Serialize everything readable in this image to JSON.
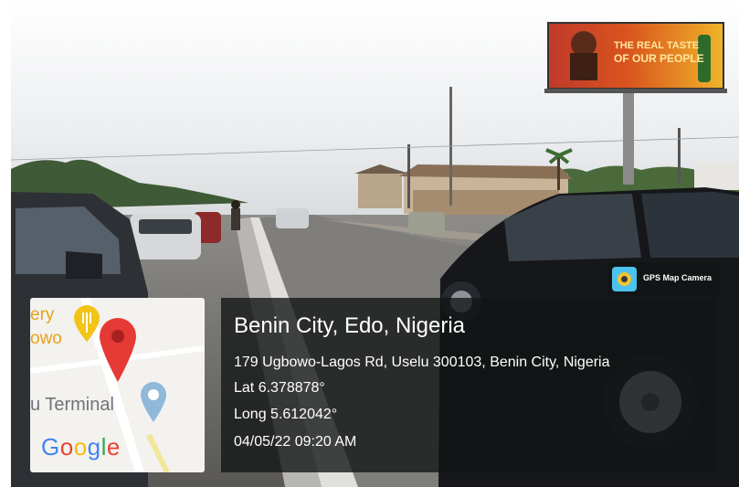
{
  "billboard": {
    "line1": "THE REAL TASTE",
    "line2": "OF OUR PEOPLE"
  },
  "map": {
    "poi_top_1": "ery",
    "poi_top_2": "owo",
    "poi_terminal": "u Terminal",
    "logo_letters": [
      "G",
      "o",
      "o",
      "g",
      "l",
      "e"
    ]
  },
  "watermark": {
    "label": "GPS Map Camera",
    "icon": "gps-map-camera-icon"
  },
  "location": {
    "title": "Benin City, Edo, Nigeria",
    "address": "179 Ugbowo-Lagos Rd, Uselu 300103, Benin City, Nigeria",
    "lat": "Lat 6.378878°",
    "long": "Long 5.612042°",
    "datetime": "04/05/22 09:20 AM"
  },
  "colors": {
    "pin_red": "#e53935",
    "fork_pin_yellow": "#f2c418",
    "pin_blue": "#8fb8d9"
  }
}
